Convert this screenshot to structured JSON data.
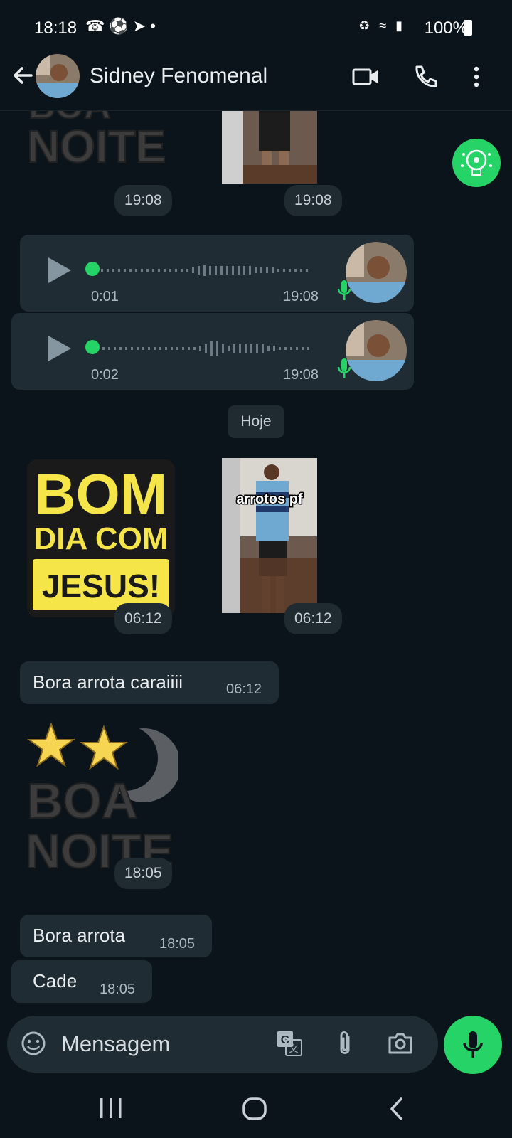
{
  "status_bar": {
    "time": "18:18",
    "battery": "100%"
  },
  "header": {
    "contact_name": "Sidney Fenomenal"
  },
  "stickers": {
    "boa_noite_line1": "BOA",
    "boa_noite_line2": "NOITE",
    "bom_dia_line1": "BOM",
    "bom_dia_line2": "DIA COM",
    "bom_dia_line3": "JESUS!",
    "video_caption": "arrotos pf"
  },
  "messages": {
    "top_sticker_time_1": "19:08",
    "top_sticker_time_2": "19:08",
    "voice_1": {
      "duration": "0:01",
      "time": "19:08"
    },
    "voice_2": {
      "duration": "0:02",
      "time": "19:08"
    },
    "date_chip": "Hoje",
    "sticker_time_3": "06:12",
    "sticker_time_4": "06:12",
    "text_1": {
      "text": "Bora arrota caraiiii",
      "time": "06:12"
    },
    "sticker_time_5": "18:05",
    "text_2": {
      "text": "Bora arrota",
      "time": "18:05"
    },
    "text_3": {
      "text": "Cade",
      "time": "18:05"
    }
  },
  "input": {
    "placeholder": "Mensagem"
  },
  "colors": {
    "background": "#0b141a",
    "bubble": "#202c33",
    "accent": "#25d366"
  },
  "icons": [
    "back-arrow-icon",
    "video-call-icon",
    "phone-icon",
    "more-options-icon",
    "play-icon",
    "mic-icon",
    "emoji-icon",
    "translate-icon",
    "attach-icon",
    "camera-icon",
    "recents-icon",
    "home-icon",
    "back-icon"
  ]
}
